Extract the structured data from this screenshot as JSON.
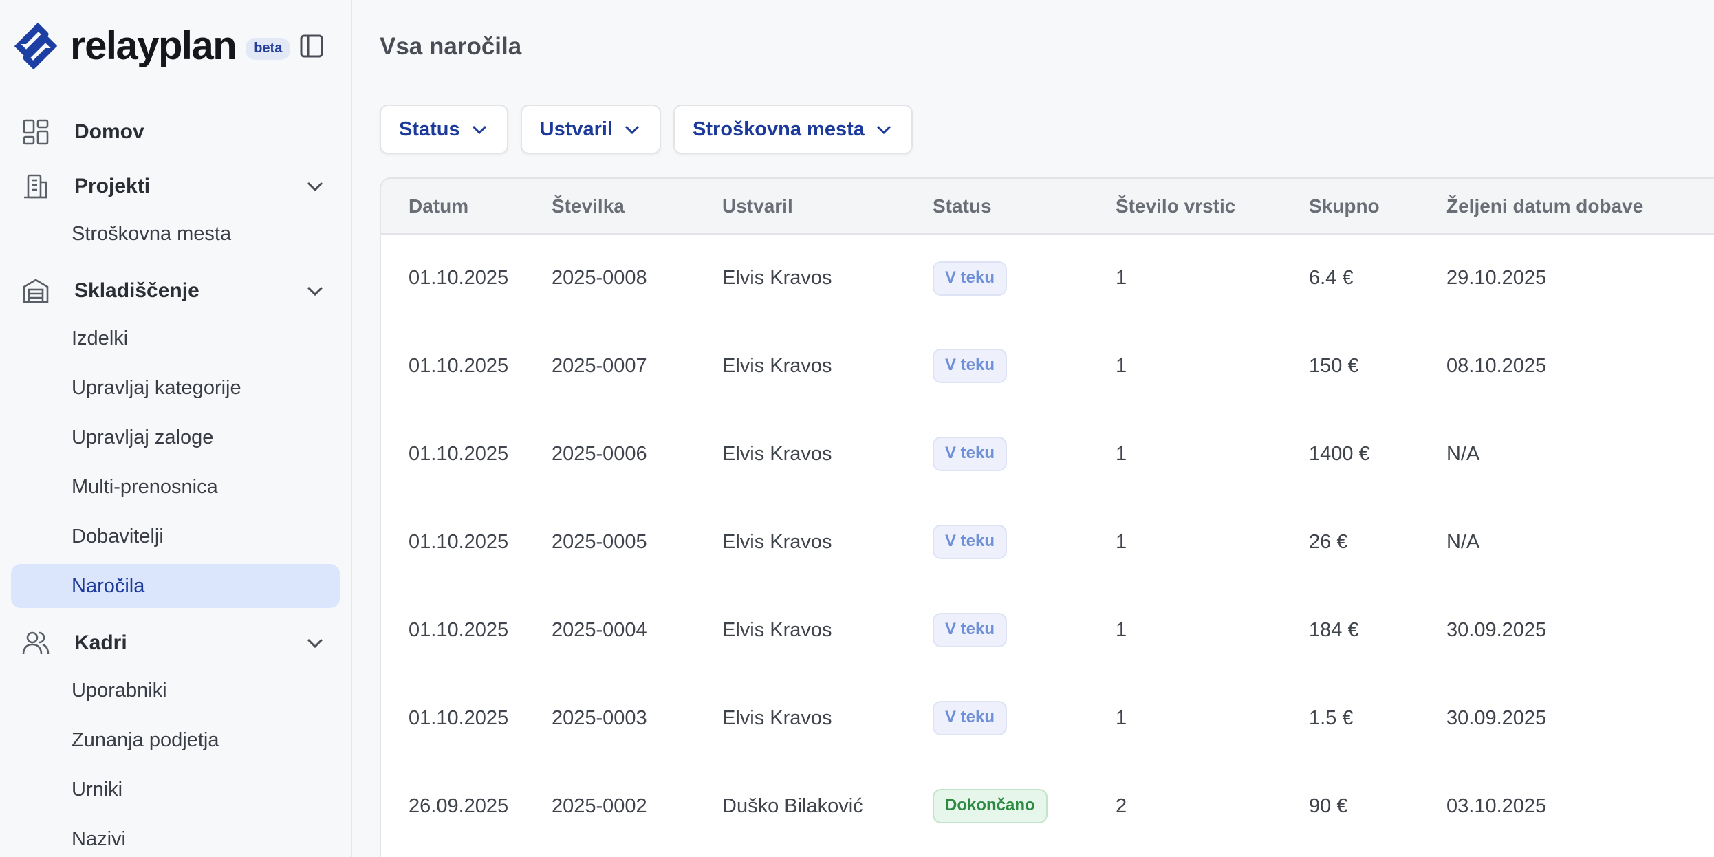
{
  "brand": {
    "name": "relayplan",
    "badge": "beta"
  },
  "sidebar": {
    "groups": [
      {
        "label": "Domov",
        "icon": "dashboard-icon"
      },
      {
        "label": "Projekti",
        "icon": "building-icon",
        "items": [
          "Stroškovna mesta"
        ]
      },
      {
        "label": "Skladiščenje",
        "icon": "warehouse-icon",
        "items": [
          "Izdelki",
          "Upravljaj kategorije",
          "Upravljaj zaloge",
          "Multi-prenosnica",
          "Dobavitelji",
          "Naročila"
        ]
      },
      {
        "label": "Kadri",
        "icon": "users-icon",
        "items": [
          "Uporabniki",
          "Zunanja podjetja",
          "Urniki",
          "Nazivi"
        ]
      }
    ],
    "active_item": "Naročila"
  },
  "main": {
    "title": "Vsa naročila",
    "filters": [
      "Status",
      "Ustvaril",
      "Stroškovna mesta"
    ],
    "table": {
      "columns": [
        "Datum",
        "Številka",
        "Ustvaril",
        "Status",
        "Število vrstic",
        "Skupno",
        "Željeni datum dobave"
      ],
      "rows": [
        [
          "01.10.2025",
          "2025-0008",
          "Elvis Kravos",
          "V teku",
          "1",
          "6.4 €",
          "29.10.2025"
        ],
        [
          "01.10.2025",
          "2025-0007",
          "Elvis Kravos",
          "V teku",
          "1",
          "150 €",
          "08.10.2025"
        ],
        [
          "01.10.2025",
          "2025-0006",
          "Elvis Kravos",
          "V teku",
          "1",
          "1400 €",
          "N/A"
        ],
        [
          "01.10.2025",
          "2025-0005",
          "Elvis Kravos",
          "V teku",
          "1",
          "26 €",
          "N/A"
        ],
        [
          "01.10.2025",
          "2025-0004",
          "Elvis Kravos",
          "V teku",
          "1",
          "184 €",
          "30.09.2025"
        ],
        [
          "01.10.2025",
          "2025-0003",
          "Elvis Kravos",
          "V teku",
          "1",
          "1.5 €",
          "30.09.2025"
        ],
        [
          "26.09.2025",
          "2025-0002",
          "Duško Bilaković",
          "Dokončano",
          "2",
          "90 €",
          "03.10.2025"
        ]
      ]
    }
  },
  "colors": {
    "accent": "#1c3a9a",
    "active_bg": "#dbe5fb",
    "status_in_progress": "#6f8fd8",
    "status_done": "#2d8a43"
  }
}
